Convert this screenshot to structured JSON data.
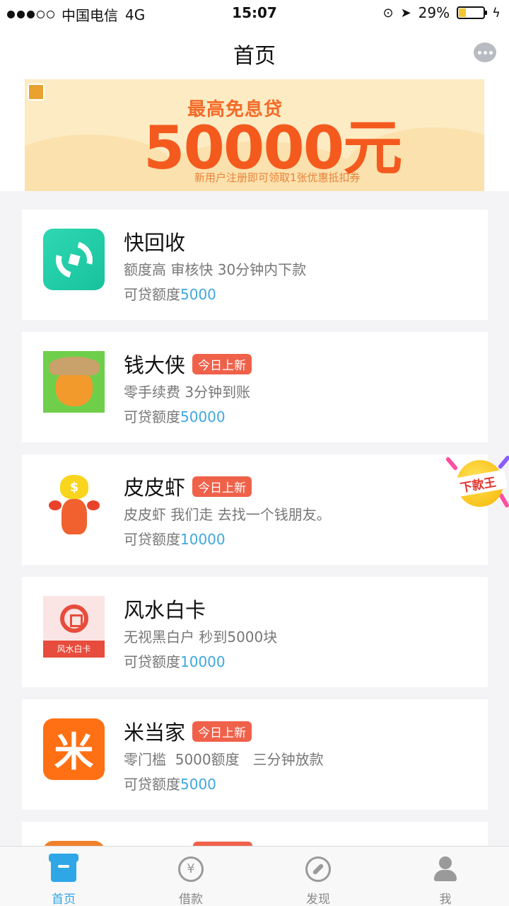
{
  "status_bar": {
    "carrier": "中国电信",
    "network": "4G",
    "time": "15:07",
    "battery": "29%",
    "battery_level": 0.29
  },
  "header": {
    "title": "首页"
  },
  "banner": {
    "headline": "最高免息贷",
    "amount": "50000元",
    "subtitle": "新用户注册即可领取1张优惠抵扣券"
  },
  "products": [
    {
      "name": "快回收",
      "badge": "",
      "desc": "额度高 审核快 30分钟内下款",
      "limit_label": "可贷额度",
      "limit_value": "5000"
    },
    {
      "name": "钱大侠",
      "badge": "今日上新",
      "desc": "零手续费 3分钟到账",
      "limit_label": "可贷额度",
      "limit_value": "50000"
    },
    {
      "name": "皮皮虾",
      "badge": "今日上新",
      "desc": "皮皮虾 我们走 去找一个钱朋友。",
      "limit_label": "可贷额度",
      "limit_value": "10000"
    },
    {
      "name": "风水白卡",
      "badge": "",
      "desc": "无视黑白户 秒到5000块",
      "limit_label": "可贷额度",
      "limit_value": "10000",
      "logo_text": "风水白卡"
    },
    {
      "name": "米当家",
      "badge": "今日上新",
      "desc": "零门槛  5000额度   三分钟放款",
      "limit_label": "可贷额度",
      "limit_value": "5000",
      "logo_text": "米"
    }
  ],
  "floating_badge": {
    "label": "下款王"
  },
  "tabs": [
    {
      "label": "首页",
      "icon": "home-icon",
      "active": true
    },
    {
      "label": "借款",
      "icon": "yen-icon",
      "active": false
    },
    {
      "label": "发现",
      "icon": "compass-icon",
      "active": false
    },
    {
      "label": "我",
      "icon": "user-icon",
      "active": false
    }
  ],
  "colors": {
    "accent": "#2fa6e6",
    "badge": "#f0614a",
    "limit_value": "#3ea8dc"
  }
}
